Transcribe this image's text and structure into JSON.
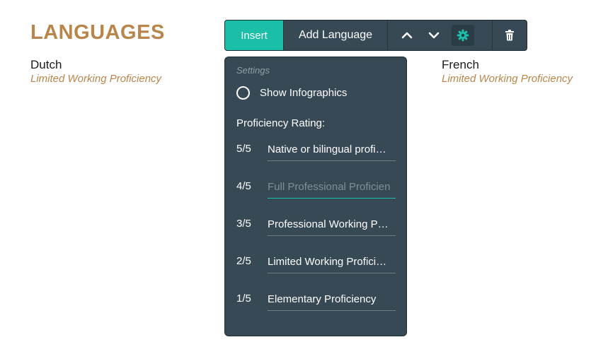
{
  "section": {
    "title": "LANGUAGES"
  },
  "languages": [
    {
      "name": "Dutch",
      "level": "Limited Working Proficiency"
    },
    {
      "name": "French",
      "level": "Limited Working Proficiency"
    }
  ],
  "toolbar": {
    "insert_label": "Insert",
    "add_label": "Add Language",
    "icons": [
      "chevron-up-icon",
      "chevron-down-icon",
      "gear-icon",
      "trash-icon"
    ]
  },
  "settings": {
    "heading": "Settings",
    "show_infographics_label": "Show Infographics",
    "show_infographics_checked": false,
    "rating_label": "Proficiency Rating:",
    "ratings": [
      {
        "score": "5/5",
        "value": "Native or bilingual profi…",
        "placeholder": ""
      },
      {
        "score": "4/5",
        "value": "",
        "placeholder": "Full Professional Proficien"
      },
      {
        "score": "3/5",
        "value": "Professional Working P…",
        "placeholder": ""
      },
      {
        "score": "2/5",
        "value": "Limited Working Profici…",
        "placeholder": ""
      },
      {
        "score": "1/5",
        "value": "Elementary Proficiency",
        "placeholder": ""
      }
    ]
  },
  "colors": {
    "accent": "#1bbfa8",
    "title": "#b8864b",
    "panel": "#364954"
  }
}
